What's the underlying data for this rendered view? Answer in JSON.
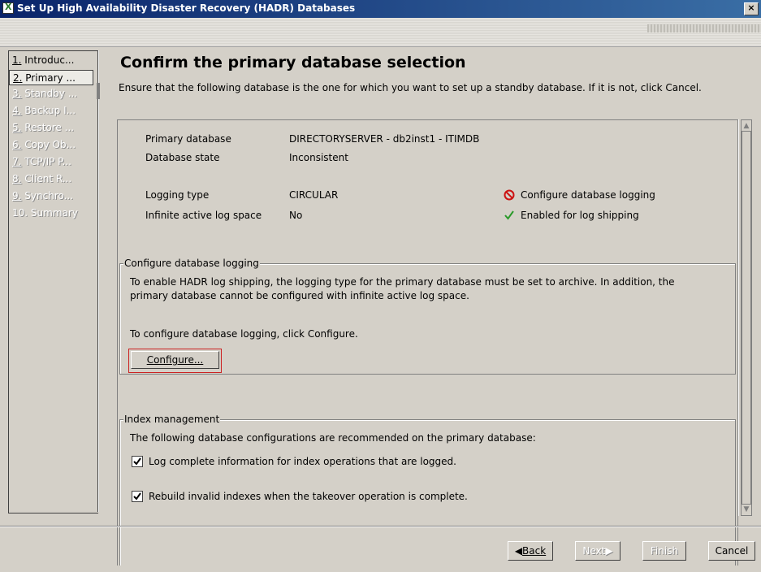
{
  "window": {
    "title": "Set Up High Availability Disaster Recovery (HADR) Databases",
    "close_label": "×"
  },
  "nav": {
    "items": [
      {
        "num": "1.",
        "label": "Introduc...",
        "state": "enabled"
      },
      {
        "num": "2.",
        "label": "Primary ...",
        "state": "selected"
      },
      {
        "num": "3.",
        "label": "Standby ...",
        "state": "disabled"
      },
      {
        "num": "4.",
        "label": "Backup I...",
        "state": "disabled"
      },
      {
        "num": "5.",
        "label": "Restore ...",
        "state": "disabled"
      },
      {
        "num": "6.",
        "label": "Copy Ob...",
        "state": "disabled"
      },
      {
        "num": "7.",
        "label": "TCP/IP P...",
        "state": "disabled"
      },
      {
        "num": "8.",
        "label": "Client R...",
        "state": "disabled"
      },
      {
        "num": "9.",
        "label": "Synchro...",
        "state": "disabled"
      },
      {
        "num": "10.",
        "label": "Summary",
        "state": "disabled"
      }
    ]
  },
  "page": {
    "title": "Confirm the primary database selection",
    "description": "Ensure that the following database is the one for which you want to set up a standby database. If it is not, click Cancel."
  },
  "details": {
    "primary_db_label": "Primary database",
    "primary_db_value": "DIRECTORYSERVER - db2inst1 - ITIMDB",
    "db_state_label": "Database state",
    "db_state_value": "Inconsistent",
    "logging_type_label": "Logging type",
    "logging_type_value": "CIRCULAR",
    "infinite_log_label": "Infinite active log space",
    "infinite_log_value": "No",
    "status_configure": "Configure database logging",
    "status_configure_icon": "error-icon",
    "status_enabled": "Enabled for log shipping",
    "status_enabled_icon": "checkmark-icon",
    "colors": {
      "error": "#cc1111",
      "ok": "#2a9a2a"
    }
  },
  "logging_group": {
    "legend": "Configure database logging",
    "text": "To enable HADR log shipping, the logging type for the primary database must be set to archive. In addition, the primary database cannot be configured with infinite active log space.",
    "instruction": "To configure database logging, click Configure.",
    "button": "Configure..."
  },
  "index_group": {
    "legend": "Index management",
    "text": "The following database configurations are recommended on the primary database:",
    "options": [
      {
        "label": "Log complete information for index operations that are logged.",
        "checked": true
      },
      {
        "label": "Rebuild invalid indexes when the takeover operation is complete.",
        "checked": true
      }
    ]
  },
  "footer": {
    "back": "Back",
    "next": "Next",
    "finish": "Finish",
    "cancel": "Cancel"
  }
}
